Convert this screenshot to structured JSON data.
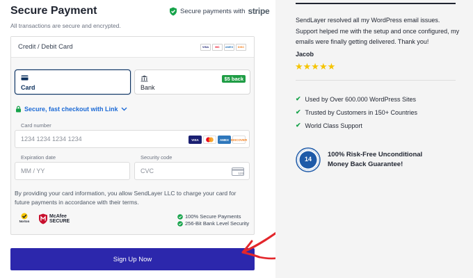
{
  "header": {
    "title": "Secure Payment",
    "subtitle": "All transactions are secure and encrypted.",
    "stripe_text": "Secure payments with",
    "stripe_brand": "stripe"
  },
  "payment_panel": {
    "header_label": "Credit / Debit Card",
    "mini_logos": [
      "VISA",
      "MC",
      "AMEX",
      "DISC"
    ],
    "tabs": [
      {
        "label": "Card",
        "icon": "credit-card-icon",
        "selected": true
      },
      {
        "label": "Bank",
        "icon": "bank-icon",
        "badge": "$5 back",
        "selected": false
      }
    ],
    "link_text": "Secure, fast checkout with Link",
    "card_number": {
      "label": "Card number",
      "placeholder": "1234 1234 1234 1234"
    },
    "card_brands": [
      "VISA",
      "MC",
      "AMEX",
      "DISCOVER"
    ],
    "expiration": {
      "label": "Expiration date",
      "placeholder": "MM / YY"
    },
    "security": {
      "label": "Security code",
      "placeholder": "CVC",
      "cvc_hint": "123"
    },
    "disclaimer": "By providing your card information, you allow SendLayer LLC to charge your card for future payments in accordance with their terms.",
    "norton_label": "Norton",
    "mcafee_label": "McAfee SECURE",
    "secure_items": [
      "100% Secure Payments",
      "256-Bit Bank Level Security"
    ]
  },
  "signup_button": "Sign Up Now",
  "sidebar": {
    "testimonial": "SendLayer resolved all my WordPress email issues. Support helped me with the setup and once configured, my emails were finally getting delivered. Thank you!",
    "author": "Jacob",
    "stars": "★★★★★",
    "rating": 5,
    "features": [
      "Used by Over 600.000 WordPress Sites",
      "Trusted by Customers in 150+ Countries",
      "World Class Support"
    ],
    "guarantee_days": "14",
    "guarantee": "100% Risk-Free Unconditional Money Back Guarantee!"
  },
  "colors": {
    "accent": "#2c27ac",
    "selected_border": "#0a2f5c",
    "link": "#1d6bd6",
    "success": "#16a34a",
    "star": "#f5c400",
    "arrow": "#e3262b"
  }
}
